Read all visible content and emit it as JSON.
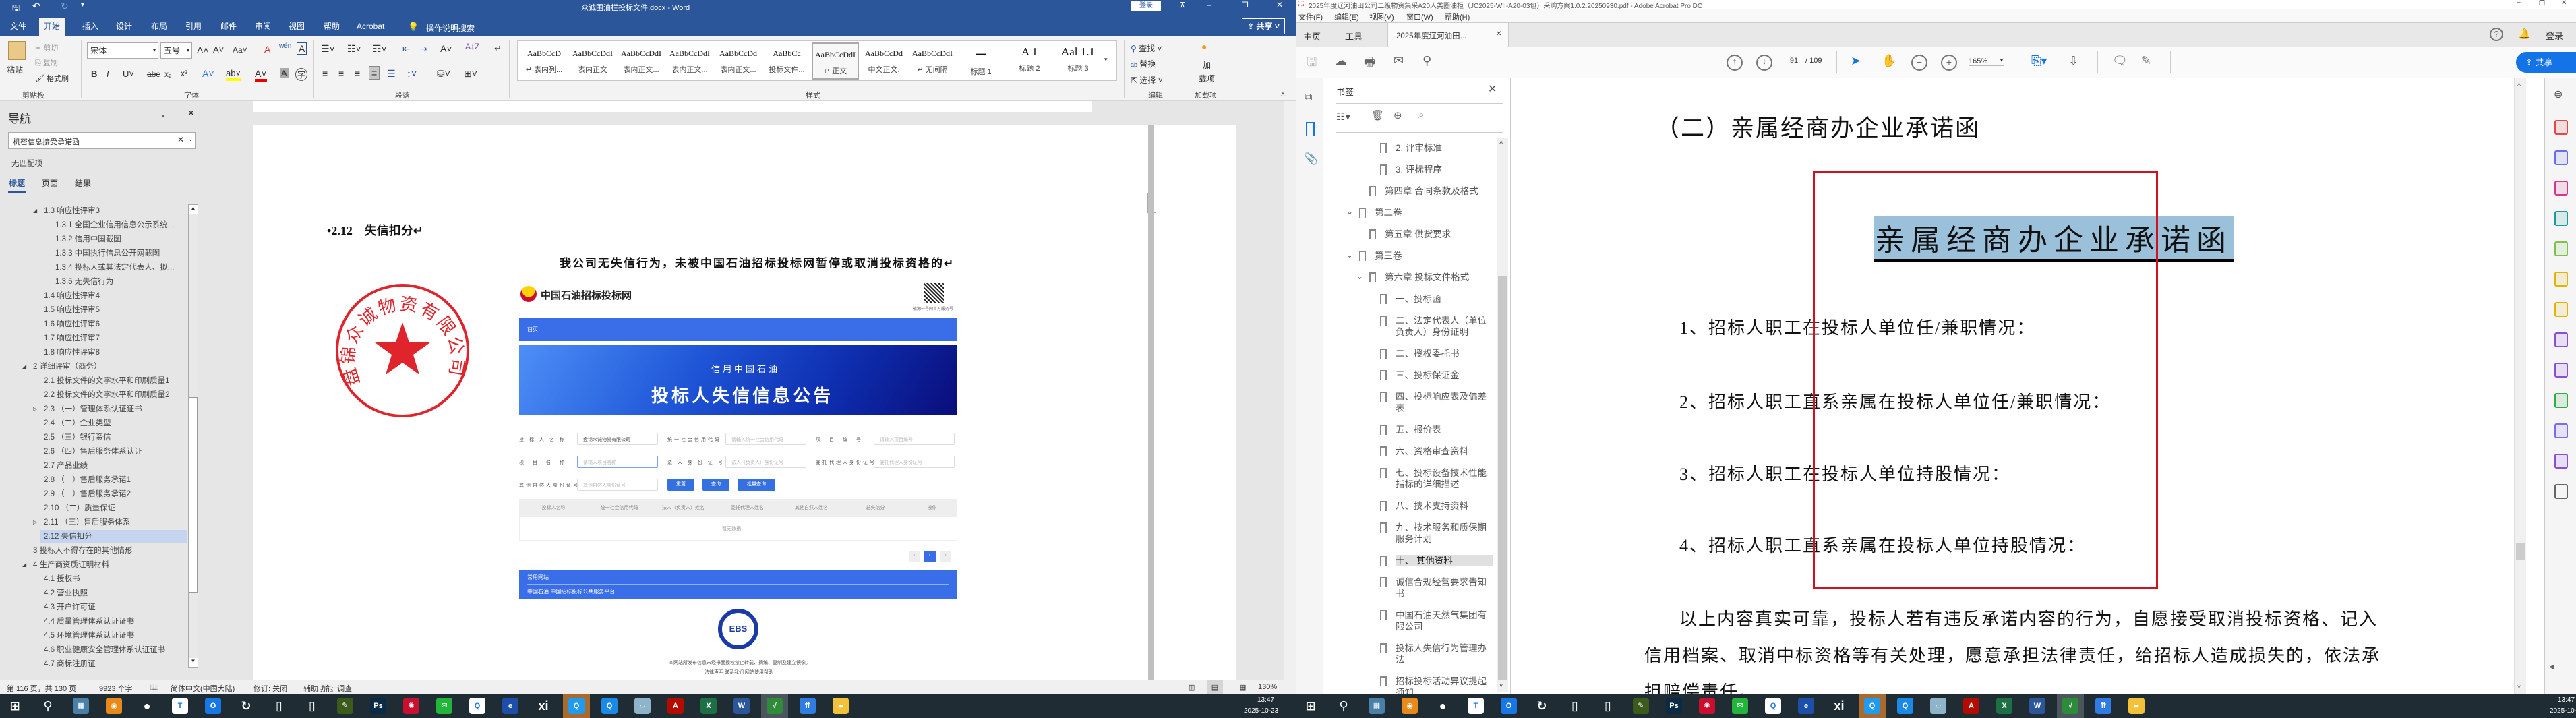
{
  "word": {
    "title": "众诚围油栏投标文件.docx  -  Word",
    "login": "登录",
    "share": "共享",
    "tabs": [
      "文件",
      "开始",
      "插入",
      "设计",
      "布局",
      "引用",
      "邮件",
      "审阅",
      "视图",
      "帮助",
      "Acrobat"
    ],
    "active_tab": 1,
    "tell_me": "操作说明搜索",
    "ribbon": {
      "clipboard": {
        "paste": "粘贴",
        "cut": "剪切",
        "copy": "复制",
        "format_painter": "格式刷",
        "label": "剪贴板"
      },
      "font": {
        "name": "宋体",
        "size": "五号",
        "label": "字体"
      },
      "paragraph": {
        "label": "段落"
      },
      "styles": {
        "label": "样式",
        "items": [
          {
            "preview": "AaBbCcD",
            "name": "↵ 表内列..."
          },
          {
            "preview": "AaBbCcDdI",
            "name": "表内正文"
          },
          {
            "preview": "AaBbCcDdI",
            "name": "表内正文..."
          },
          {
            "preview": "AaBbCcDdI",
            "name": "表内正文..."
          },
          {
            "preview": "AaBbCcDd",
            "name": "表内正文..."
          },
          {
            "preview": "AaBbCc",
            "name": "投标文件..."
          },
          {
            "preview": "AaBbCcDdI",
            "name": "↵ 正文"
          },
          {
            "preview": "AaBbCcDd",
            "name": "中文正文."
          },
          {
            "preview": "AaBbCcDdI",
            "name": "↵ 无间隔"
          },
          {
            "preview": "一",
            "name": "标题 1"
          },
          {
            "preview": "A 1",
            "name": "标题 2"
          },
          {
            "preview": "Aal 1.1",
            "name": "标题 3"
          }
        ],
        "selected": 6
      },
      "editing": {
        "find": "查找",
        "replace": "替换",
        "select": "选择",
        "label": "编辑"
      },
      "addins": {
        "button_line1": "加",
        "button_line2": "载项",
        "label": "加载项"
      }
    },
    "nav": {
      "title": "导航",
      "search_value": "机密信息接受承诺函",
      "no_match": "无匹配项",
      "tabs": [
        "标题",
        "页面",
        "结果"
      ],
      "items": [
        {
          "text": "1.3 响应性评审3",
          "level": 2,
          "arrow": "expanded"
        },
        {
          "text": "1.3.1 全国企业信用信息公示系统...",
          "level": 3
        },
        {
          "text": "1.3.2 信用中国截图",
          "level": 3
        },
        {
          "text": "1.3.3 中国执行信息公开网截图",
          "level": 3
        },
        {
          "text": "1.3.4 投标人或其法定代表人、拟...",
          "level": 3
        },
        {
          "text": "1.3.5 无失信行为",
          "level": 3
        },
        {
          "text": "1.4 响应性评审4",
          "level": 2
        },
        {
          "text": "1.5 响应性评审5",
          "level": 2
        },
        {
          "text": "1.6 响应性评审6",
          "level": 2
        },
        {
          "text": "1.7 响应性评审7",
          "level": 2
        },
        {
          "text": "1.8 响应性评审8",
          "level": 2
        },
        {
          "text": "2 详细评审（商务）",
          "level": 1,
          "arrow": "expanded"
        },
        {
          "text": "2.1 投标文件的文字水平和印刷质量1",
          "level": 2
        },
        {
          "text": "2.2 投标文件的文字水平和印刷质量2",
          "level": 2
        },
        {
          "text": "2.3 （一）管理体系认证证书",
          "level": 2,
          "arrow": "collapsed"
        },
        {
          "text": "2.4 （二）企业类型",
          "level": 2
        },
        {
          "text": "2.5 （三）银行资信",
          "level": 2
        },
        {
          "text": "2.6 （四）售后服务体系认证",
          "level": 2
        },
        {
          "text": "2.7 产品业绩",
          "level": 2
        },
        {
          "text": "2.8 （一）售后服务承诺1",
          "level": 2
        },
        {
          "text": "2.9 （一）售后服务承诺2",
          "level": 2
        },
        {
          "text": "2.10 （二）质量保证",
          "level": 2
        },
        {
          "text": "2.11 （三）售后服务体系",
          "level": 2,
          "arrow": "collapsed"
        },
        {
          "text": "2.12 失信扣分",
          "level": 2,
          "selected": true
        },
        {
          "text": "3 投标人不得存在的其他情形",
          "level": 1
        },
        {
          "text": "4 生产商资质证明材料",
          "level": 1,
          "arrow": "expanded"
        },
        {
          "text": "4.1 授权书",
          "level": 2
        },
        {
          "text": "4.2 营业执照",
          "level": 2
        },
        {
          "text": "4.3 开户许可证",
          "level": 2
        },
        {
          "text": "4.4 质量管理体系认证证书",
          "level": 2
        },
        {
          "text": "4.5 环境管理体系认证证书",
          "level": 2
        },
        {
          "text": "4.6 职业健康安全管理体系认证证书",
          "level": 2
        },
        {
          "text": "4.7 商标注册证",
          "level": 2
        }
      ]
    },
    "doc": {
      "heading_bullet": "•",
      "heading": "2.12　失信扣分↵",
      "statement": "我公司无失信行为，未被中国石油招标投标网暂停或取消投标资格的↵",
      "seal_text": "盘锦众诚物资有限公司"
    },
    "website": {
      "logo_text": "中国石油招标投标网",
      "qr_caption": "能源一号网官方服务号",
      "nav_home": "首页",
      "banner_sub": "信用中国石油",
      "banner_title": "投标人失信信息公告",
      "form": [
        {
          "label": "投 标 人 名 称",
          "value": "盘锦众诚物资有限公司"
        },
        {
          "label": "统一社会信用代码",
          "placeholder": "请输入统一社会信用代码"
        },
        {
          "label": "项　目　编　号",
          "placeholder": "请输入项目编号"
        },
        {
          "label": "项　目　名　称",
          "placeholder": "请输入项目名称"
        },
        {
          "label": "法 人 身 份 证 号",
          "placeholder": "法人（负责人）身份证号"
        },
        {
          "label": "委托代理人身份证号",
          "placeholder": "委托代理人身份证号"
        },
        {
          "label": "其他自然人身份证号",
          "placeholder": "其他自然人身份证号"
        }
      ],
      "buttons": [
        "重置",
        "查询",
        "批量查询"
      ],
      "table_headers": [
        "投标人名称",
        "统一社会信用代码",
        "法人（负责人）姓名",
        "委托代理人姓名",
        "其他自然人姓名",
        "总失信分",
        "操作"
      ],
      "empty_text": "暂无数据",
      "current_page": "1",
      "footer_title": "常用网站",
      "footer_links": "中国石油 中国招标投标公共服务平台",
      "ebs_logo": "EBS",
      "disclaimer": "本网站所发布信息未经书面授权禁止转载、摘编、复制及建立镜像。",
      "legal_links": "法律声明 联系我们 网站使用帮助"
    },
    "status": {
      "page": "第 116 页，共 130 页",
      "words": "9923 个字",
      "language": "简体中文(中国大陆)",
      "track": "修订: 关闭",
      "accessibility": "辅助功能: 调查",
      "zoom": "130%"
    }
  },
  "acrobat": {
    "title": "2025年度辽河油田公司二级物资集采A20人类圈油柜（JC2025-WII-A20-03包）采购方案1.0.2.20250930.pdf - Adobe Acrobat Pro DC",
    "menu": [
      "文件(F)",
      "编辑(E)",
      "视图(V)",
      "窗口(W)",
      "帮助(H)"
    ],
    "tab_home": "主页",
    "tab_tools": "工具",
    "doc_tab": "2025年度辽河油田...",
    "login": "登录",
    "page_current": "91",
    "page_total": "/ 109",
    "zoom": "165%",
    "share": "共享",
    "bookmarks": {
      "title": "书签",
      "items": [
        {
          "text": "2. 评审标准",
          "level": 3
        },
        {
          "text": "3. 评标程序",
          "level": 3
        },
        {
          "text": "第四章  合同条款及格式",
          "level": 2
        },
        {
          "text": "第二卷",
          "level": 1,
          "expanded": true
        },
        {
          "text": "第五章  供货要求",
          "level": 2
        },
        {
          "text": "第三卷",
          "level": 1,
          "expanded": true
        },
        {
          "text": "第六章  投标文件格式",
          "level": 2,
          "expanded": true
        },
        {
          "text": "一、投标函",
          "level": 3
        },
        {
          "text": "二、法定代表人（单位负责人）身份证明",
          "level": 3
        },
        {
          "text": "二、授权委托书",
          "level": 3
        },
        {
          "text": "三、投标保证金",
          "level": 3
        },
        {
          "text": "四、投标响应表及偏差表",
          "level": 3
        },
        {
          "text": "五、报价表",
          "level": 3
        },
        {
          "text": "六、资格审查资料",
          "level": 3
        },
        {
          "text": "七、投标设备技术性能指标的详细描述",
          "level": 3
        },
        {
          "text": "八、技术支持资料",
          "level": 3
        },
        {
          "text": "九、技术服务和质保期服务计划",
          "level": 3
        },
        {
          "text": "十、 其他资料",
          "level": 3,
          "selected": true
        },
        {
          "text": "诚信合规经营要求告知书",
          "level": 3
        },
        {
          "text": "中国石油天然气集团有限公司",
          "level": 3
        },
        {
          "text": "投标人失信行为管理办法",
          "level": 3
        },
        {
          "text": "招标投标活动异议提起须知",
          "level": 3
        }
      ]
    },
    "pdf": {
      "section_heading": "（二）亲属经商办企业承诺函",
      "title": "亲属经商办企业承诺函",
      "items": [
        "1、招标人职工在投标人单位任/兼职情况：",
        "2、招标人职工直系亲属在投标人单位任/兼职情况：",
        "3、招标人职工在投标人单位持股情况：",
        "4、招标人职工直系亲属在投标人单位持股情况："
      ],
      "paragraph": [
        "以上内容真实可靠，投标人若有违反承诺内容的行为，自愿接受取消投标资格、记入",
        "信用档案、取消中标资格等有关处理，愿意承担法律责任，给招标人造成损失的，依法承",
        "担赔偿责任。"
      ],
      "annotation_color": "#d0121f",
      "highlight_color": "#9ac0da"
    }
  },
  "taskbar": {
    "time": "13:47",
    "date": "2025-10-23",
    "icons": [
      {
        "name": "start",
        "glyph": "⊞",
        "color": "#1f2c33"
      },
      {
        "name": "search",
        "glyph": "⚲",
        "color": "#1f2c33"
      },
      {
        "name": "calculator",
        "glyph": "▦",
        "color": "#4a7fa8"
      },
      {
        "name": "camera",
        "glyph": "◉",
        "color": "#e88a1a"
      },
      {
        "name": "dots",
        "glyph": "●",
        "color": "#1f2c33"
      },
      {
        "name": "todesk",
        "glyph": "T",
        "color": "#ffffff"
      },
      {
        "name": "app-blue",
        "glyph": "O",
        "color": "#1877e6"
      },
      {
        "name": "sync",
        "glyph": "↻",
        "color": "#1f2c33"
      },
      {
        "name": "printer",
        "glyph": "▯",
        "color": "#1f2c33"
      },
      {
        "name": "file",
        "glyph": "▯",
        "color": "#1f2c33"
      },
      {
        "name": "pen",
        "glyph": "✎",
        "color": "#3c5a1a"
      },
      {
        "name": "photoshop",
        "glyph": "Ps",
        "color": "#0a2a45"
      },
      {
        "name": "petrochina",
        "glyph": "✺",
        "color": "#c8102e"
      },
      {
        "name": "wechat",
        "glyph": "✉",
        "color": "#23b43a"
      },
      {
        "name": "qq",
        "glyph": "Q",
        "color": "#ffffff"
      },
      {
        "name": "browser-ie",
        "glyph": "e",
        "color": "#1d4fa8"
      },
      {
        "name": "xi",
        "glyph": "xi",
        "color": "#1f2c33"
      },
      {
        "name": "qq-browser",
        "glyph": "Q",
        "color": "#1f9bf0",
        "active": "#a76b30"
      },
      {
        "name": "browser",
        "glyph": "Q",
        "color": "#1a8ae6"
      },
      {
        "name": "notepad",
        "glyph": "▱",
        "color": "#8fb3c8"
      },
      {
        "name": "acrobat",
        "glyph": "A",
        "color": "#b30b00"
      },
      {
        "name": "excel",
        "glyph": "X",
        "color": "#1d7044"
      },
      {
        "name": "word",
        "glyph": "W",
        "color": "#2b579a"
      },
      {
        "name": "green-app",
        "glyph": "√",
        "color": "#2e8b3a",
        "active": "#4a565c"
      },
      {
        "name": "app-doc",
        "glyph": "⇈",
        "color": "#2f7de1"
      },
      {
        "name": "folder",
        "glyph": "▰",
        "color": "#f3c13a"
      }
    ]
  }
}
